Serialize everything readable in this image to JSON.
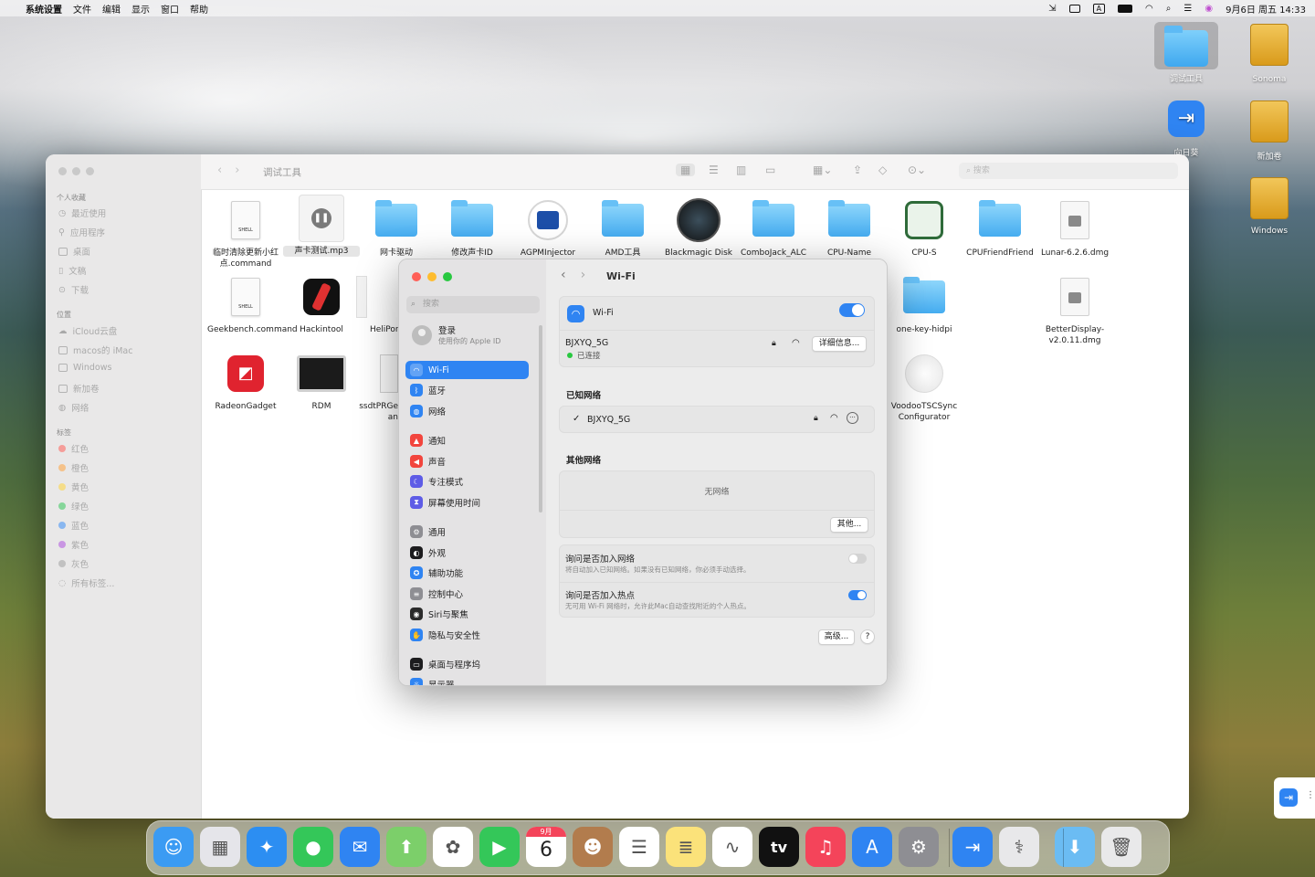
{
  "menubar": {
    "app": "系统设置",
    "items": [
      "文件",
      "编辑",
      "显示",
      "窗口",
      "帮助"
    ],
    "datetime": "9月6日 周五 14:33",
    "input_indicator": "A"
  },
  "desktop": {
    "icons": [
      {
        "label": "调试工具",
        "kind": "folder"
      },
      {
        "label": "Sonoma",
        "kind": "drive"
      },
      {
        "label": "向日葵",
        "kind": "app"
      },
      {
        "label": "新加卷",
        "kind": "drive"
      },
      {
        "label": "Windows",
        "kind": "drive"
      }
    ]
  },
  "finder": {
    "title": "调试工具",
    "search_placeholder": "搜索",
    "sidebar": {
      "favorites_header": "个人收藏",
      "favorites": [
        "最近使用",
        "应用程序",
        "桌面",
        "文稿",
        "下载"
      ],
      "locations_header": "位置",
      "locations": [
        "iCloud云盘",
        "macos的 iMac",
        "Windows",
        "新加卷",
        "网络"
      ],
      "tags_header": "标签",
      "tags": [
        {
          "label": "红色",
          "color": "#ff5f57"
        },
        {
          "label": "橙色",
          "color": "#ffa23d"
        },
        {
          "label": "黄色",
          "color": "#ffd43b"
        },
        {
          "label": "绿色",
          "color": "#34c759"
        },
        {
          "label": "蓝色",
          "color": "#3a8ef6"
        },
        {
          "label": "紫色",
          "color": "#af52de"
        },
        {
          "label": "灰色",
          "color": "#a0a0a0"
        }
      ],
      "all_tags": "所有标签..."
    },
    "files": [
      {
        "label": "临时清除更新小红点.command",
        "kind": "shell"
      },
      {
        "label": "声卡测试.mp3",
        "kind": "audio"
      },
      {
        "label": "网卡驱动",
        "kind": "folder"
      },
      {
        "label": "修改声卡ID",
        "kind": "folder"
      },
      {
        "label": "AGPMInjector",
        "kind": "app"
      },
      {
        "label": "AMD工具",
        "kind": "folder"
      },
      {
        "label": "Blackmagic Disk",
        "kind": "app"
      },
      {
        "label": "ComboJack_ALC",
        "kind": "folder"
      },
      {
        "label": "CPU-Name",
        "kind": "folder"
      },
      {
        "label": "CPU-S",
        "kind": "app"
      },
      {
        "label": "CPUFriendFriend",
        "kind": "folder"
      },
      {
        "label": "Lunar-6.2.6.dmg",
        "kind": "dmg"
      },
      {
        "label": "Geekbench.command",
        "kind": "shell"
      },
      {
        "label": "Hackintool",
        "kind": "app"
      },
      {
        "label": "HeliPor",
        "kind": "app"
      },
      {
        "label": "one-key-hidpi",
        "kind": "folder"
      },
      {
        "label": "BetterDisplay-v2.0.11.dmg",
        "kind": "dmg"
      },
      {
        "label": "RadeonGadget",
        "kind": "app"
      },
      {
        "label": "RDM",
        "kind": "app"
      },
      {
        "label": "ssdtPRGe an",
        "kind": "shell"
      },
      {
        "label": "VoodooTSCSync Configurator",
        "kind": "app"
      }
    ]
  },
  "settings": {
    "title": "Wi-Fi",
    "search_placeholder": "搜索",
    "login": {
      "title": "登录",
      "subtitle": "使用你的 Apple ID"
    },
    "sidebar_items": [
      {
        "label": "Wi-Fi",
        "color": "#2f84f2",
        "icon": "wifi-icon",
        "glyph": "◠",
        "active": true
      },
      {
        "label": "蓝牙",
        "color": "#2f84f2",
        "icon": "bluetooth-icon",
        "glyph": "ᛒ",
        "active": false
      },
      {
        "label": "网络",
        "color": "#2f84f2",
        "icon": "globe-icon",
        "glyph": "◍",
        "active": false
      },
      {
        "label": "通知",
        "color": "#f2453d",
        "icon": "bell-icon",
        "glyph": "▲",
        "active": false
      },
      {
        "label": "声音",
        "color": "#f2453d",
        "icon": "speaker-icon",
        "glyph": "◀",
        "active": false
      },
      {
        "label": "专注模式",
        "color": "#5e5ce6",
        "icon": "moon-icon",
        "glyph": "☾",
        "active": false
      },
      {
        "label": "屏幕使用时间",
        "color": "#5e5ce6",
        "icon": "hourglass-icon",
        "glyph": "⧗",
        "active": false
      },
      {
        "label": "通用",
        "color": "#8e8e93",
        "icon": "gear-icon",
        "glyph": "⚙",
        "active": false
      },
      {
        "label": "外观",
        "color": "#1c1c1e",
        "icon": "appearance-icon",
        "glyph": "◐",
        "active": false
      },
      {
        "label": "辅助功能",
        "color": "#2f84f2",
        "icon": "accessibility-icon",
        "glyph": "✪",
        "active": false
      },
      {
        "label": "控制中心",
        "color": "#8e8e93",
        "icon": "control-center-icon",
        "glyph": "≡",
        "active": false
      },
      {
        "label": "Siri与聚焦",
        "color": "#2b2b2b",
        "icon": "siri-icon",
        "glyph": "◉",
        "active": false
      },
      {
        "label": "隐私与安全性",
        "color": "#2f84f2",
        "icon": "hand-icon",
        "glyph": "✋",
        "active": false
      },
      {
        "label": "桌面与程序坞",
        "color": "#1c1c1e",
        "icon": "dock-icon",
        "glyph": "▭",
        "active": false
      },
      {
        "label": "显示器",
        "color": "#2f84f2",
        "icon": "display-icon",
        "glyph": "☼",
        "active": false
      }
    ],
    "wifi": {
      "label": "Wi-Fi",
      "enabled": true,
      "current_network": "BJXYQ_5G",
      "status": "已连接",
      "details_button": "详细信息..."
    },
    "known_networks_header": "已知网络",
    "known_networks": [
      {
        "name": "BJXYQ_5G",
        "checked": true
      }
    ],
    "other_networks_header": "其他网络",
    "no_networks": "无网络",
    "other_button": "其他...",
    "ask_join_networks": {
      "title": "询问是否加入网络",
      "desc": "将自动加入已知网络。如果没有已知网络，你必须手动选择。",
      "enabled": false
    },
    "ask_join_hotspot": {
      "title": "询问是否加入热点",
      "desc": "无可用 Wi-Fi 网络时，允许此Mac自动查找附近的个人热点。",
      "enabled": true
    },
    "advanced_button": "高级...",
    "help_button": "?"
  },
  "dock": {
    "calendar_month": "9月",
    "calendar_day": "6",
    "tv_label": "tv",
    "apps": [
      {
        "name": "finder-icon",
        "color": "#3b9bf3",
        "glyph": "☺"
      },
      {
        "name": "launchpad-icon",
        "color": "#e5e5ea",
        "glyph": "▦"
      },
      {
        "name": "safari-icon",
        "color": "#2c8ef2",
        "glyph": "✦"
      },
      {
        "name": "messages-icon",
        "color": "#34c759",
        "glyph": "●"
      },
      {
        "name": "mail-icon",
        "color": "#2f84f2",
        "glyph": "✉"
      },
      {
        "name": "maps-icon",
        "color": "#7ccf6a",
        "glyph": "⬆"
      },
      {
        "name": "photos-icon",
        "color": "#ffffff",
        "glyph": "✿"
      },
      {
        "name": "facetime-icon",
        "color": "#34c759",
        "glyph": "▶"
      },
      {
        "name": "calendar-icon",
        "color": "#ffffff",
        "glyph": ""
      },
      {
        "name": "contacts-icon",
        "color": "#b27c4d",
        "glyph": "☻"
      },
      {
        "name": "reminders-icon",
        "color": "#ffffff",
        "glyph": "☰"
      },
      {
        "name": "notes-icon",
        "color": "#fbe27a",
        "glyph": "≣"
      },
      {
        "name": "freeform-icon",
        "color": "#ffffff",
        "glyph": "∿"
      },
      {
        "name": "tv-icon",
        "color": "#111111",
        "glyph": ""
      },
      {
        "name": "music-icon",
        "color": "#f4445a",
        "glyph": "♫"
      },
      {
        "name": "app-store-icon",
        "color": "#2f84f2",
        "glyph": "A"
      },
      {
        "name": "system-settings-icon",
        "color": "#8e8e93",
        "glyph": "⚙"
      },
      {
        "name": "sunlogin-icon",
        "color": "#2f84f2",
        "glyph": "⇥"
      },
      {
        "name": "disk-utility-icon",
        "color": "#e8e8ea",
        "glyph": "⚕"
      },
      {
        "name": "downloads-folder-icon",
        "color": "#6bbcf3",
        "glyph": "⬇"
      },
      {
        "name": "trash-icon",
        "color": "#e9e9ea",
        "glyph": "🗑"
      }
    ]
  }
}
